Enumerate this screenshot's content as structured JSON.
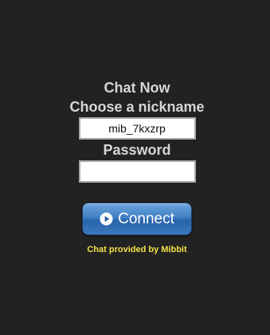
{
  "widget": {
    "title": "Chat Now",
    "nickname_label": "Choose a nickname",
    "nickname_value": "mib_7kxzrp",
    "password_label": "Password",
    "password_value": "",
    "connect_label": "Connect",
    "credit_text": "Chat provided by Mibbit"
  },
  "icons": {
    "connect": "play-circle-icon"
  },
  "colors": {
    "background": "#222222",
    "heading": "#d6d6d6",
    "button": "#3f7fc4",
    "credit": "#f2e14a"
  }
}
